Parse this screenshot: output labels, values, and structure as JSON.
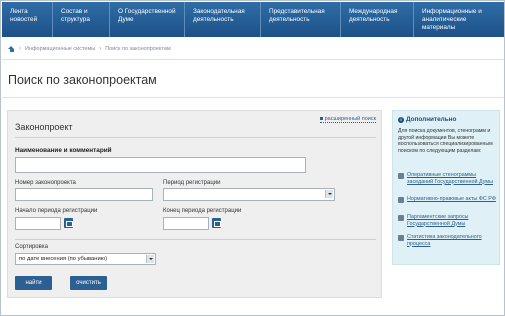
{
  "nav": {
    "items": [
      "Лента новостей",
      "Состав и структура",
      "О Государственной Думе",
      "Законодательная деятельность",
      "Представительная деятельность",
      "Международная деятельность",
      "Информационные и аналитические материалы"
    ]
  },
  "breadcrumb": {
    "items": [
      "Информационные системы",
      "Поиск по законопроектам"
    ],
    "separator": "›"
  },
  "page": {
    "title": "Поиск по законопроектам"
  },
  "form": {
    "section_title": "Законопроект",
    "advanced_search_link": "расширенный поиск",
    "name_label": "Наименование и комментарий",
    "name_value": "",
    "number_label": "Номер законопроекта",
    "number_value": "",
    "period_label": "Период регистрации",
    "period_value": "",
    "period_start_label": "Начало периода регистрации",
    "period_start_value": "",
    "period_end_label": "Конец периода регистрации",
    "period_end_value": "",
    "sort_label": "Сортировка",
    "sort_value": "по дате внесения (по убыванию)",
    "find_button": "найти",
    "clear_button": "очистить"
  },
  "sidebar": {
    "title": "Дополнительно",
    "text": "Для поиска документов, стенограмм и другой информации Вы можете воспользоваться специализированным поиском по следующим разделам:",
    "links": [
      "Оперативные стенограммы заседаний Государственной Думы",
      "Нормативно-правовые акты ФС РФ",
      "Парламентские запросы Государственной Думы",
      "Статистика законодательного процесса"
    ]
  },
  "colors": {
    "nav_background": "#1d5188",
    "button": "#2c5f92",
    "sidebar_background": "#dff1f6",
    "panel_background": "#efefef"
  }
}
